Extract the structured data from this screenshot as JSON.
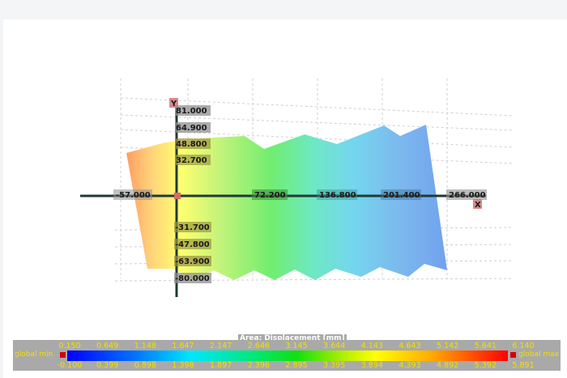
{
  "viewport": {
    "background": "#ffffff"
  },
  "axes": {
    "x_label": "X",
    "y_label": "Y",
    "x_ticks": [
      "-57.000",
      "72.200",
      "136.800",
      "201.400",
      "266.000"
    ],
    "y_ticks_pos": [
      "81.000",
      "64.900",
      "48.800",
      "32.700"
    ],
    "y_ticks_neg": [
      "-31.700",
      "-47.800",
      "-63.900",
      "-80.000"
    ]
  },
  "legend": {
    "title": "Area: Displacement [mm]",
    "global_min": "global min",
    "global_max": "global max",
    "top_values": [
      "0.150",
      "0.649",
      "1.148",
      "1.647",
      "2.147",
      "2.646",
      "3.145",
      "3.644",
      "4.143",
      "4.643",
      "5.142",
      "5.641",
      "6.140"
    ],
    "bottom_values": [
      "-0.100",
      "0.399",
      "0.898",
      "1.398",
      "1.897",
      "2.396",
      "2.895",
      "3.395",
      "3.894",
      "4.393",
      "4.892",
      "5.392",
      "5.891"
    ],
    "label_color": "#f2e000",
    "marker_color": "#d40000"
  }
}
